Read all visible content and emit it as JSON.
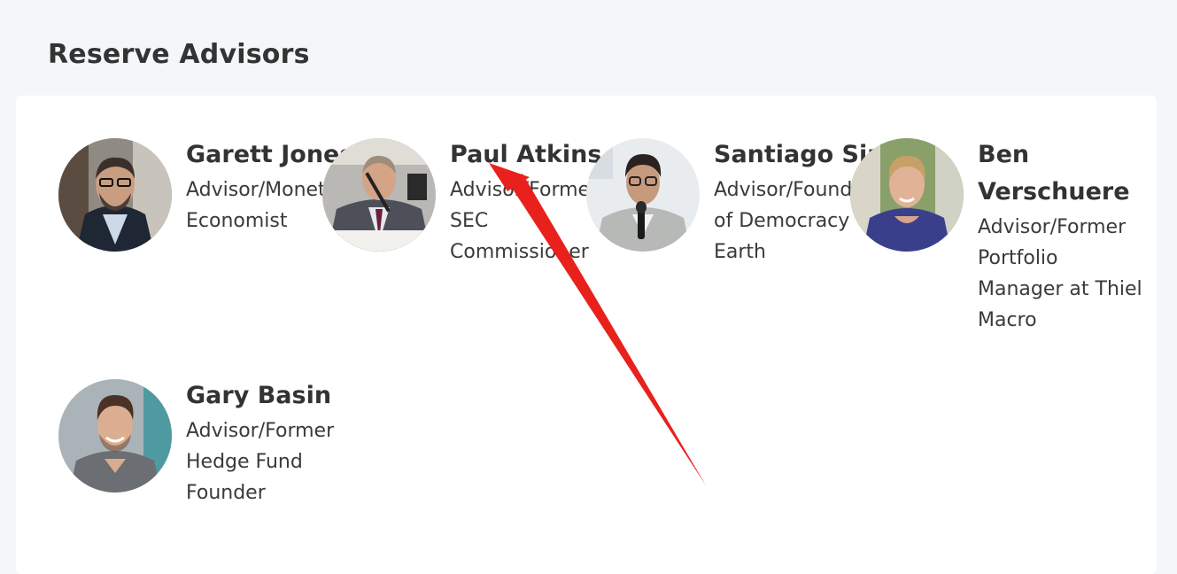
{
  "section": {
    "title": "Reserve Advisors"
  },
  "advisors": [
    {
      "name": "Garett Jones",
      "role": "Advisor/Monetary Economist"
    },
    {
      "name": "Paul Atkins",
      "role": "Advisor/Former SEC Commissioner"
    },
    {
      "name": "Santiago Siri",
      "role": "Advisor/Founder of Democracy Earth"
    },
    {
      "name": "Ben Verschuere",
      "role": "Advisor/Former Portfolio Manager at Thiel Macro"
    },
    {
      "name": "Gary Basin",
      "role": "Advisor/Former Hedge Fund Founder"
    }
  ],
  "colors": {
    "page_bg": "#f4f7fa",
    "card_bg": "#ffffff",
    "text": "#333333",
    "annotation_arrow": "#e8211d"
  },
  "icons": {
    "annotation": "red-arrow-icon"
  }
}
